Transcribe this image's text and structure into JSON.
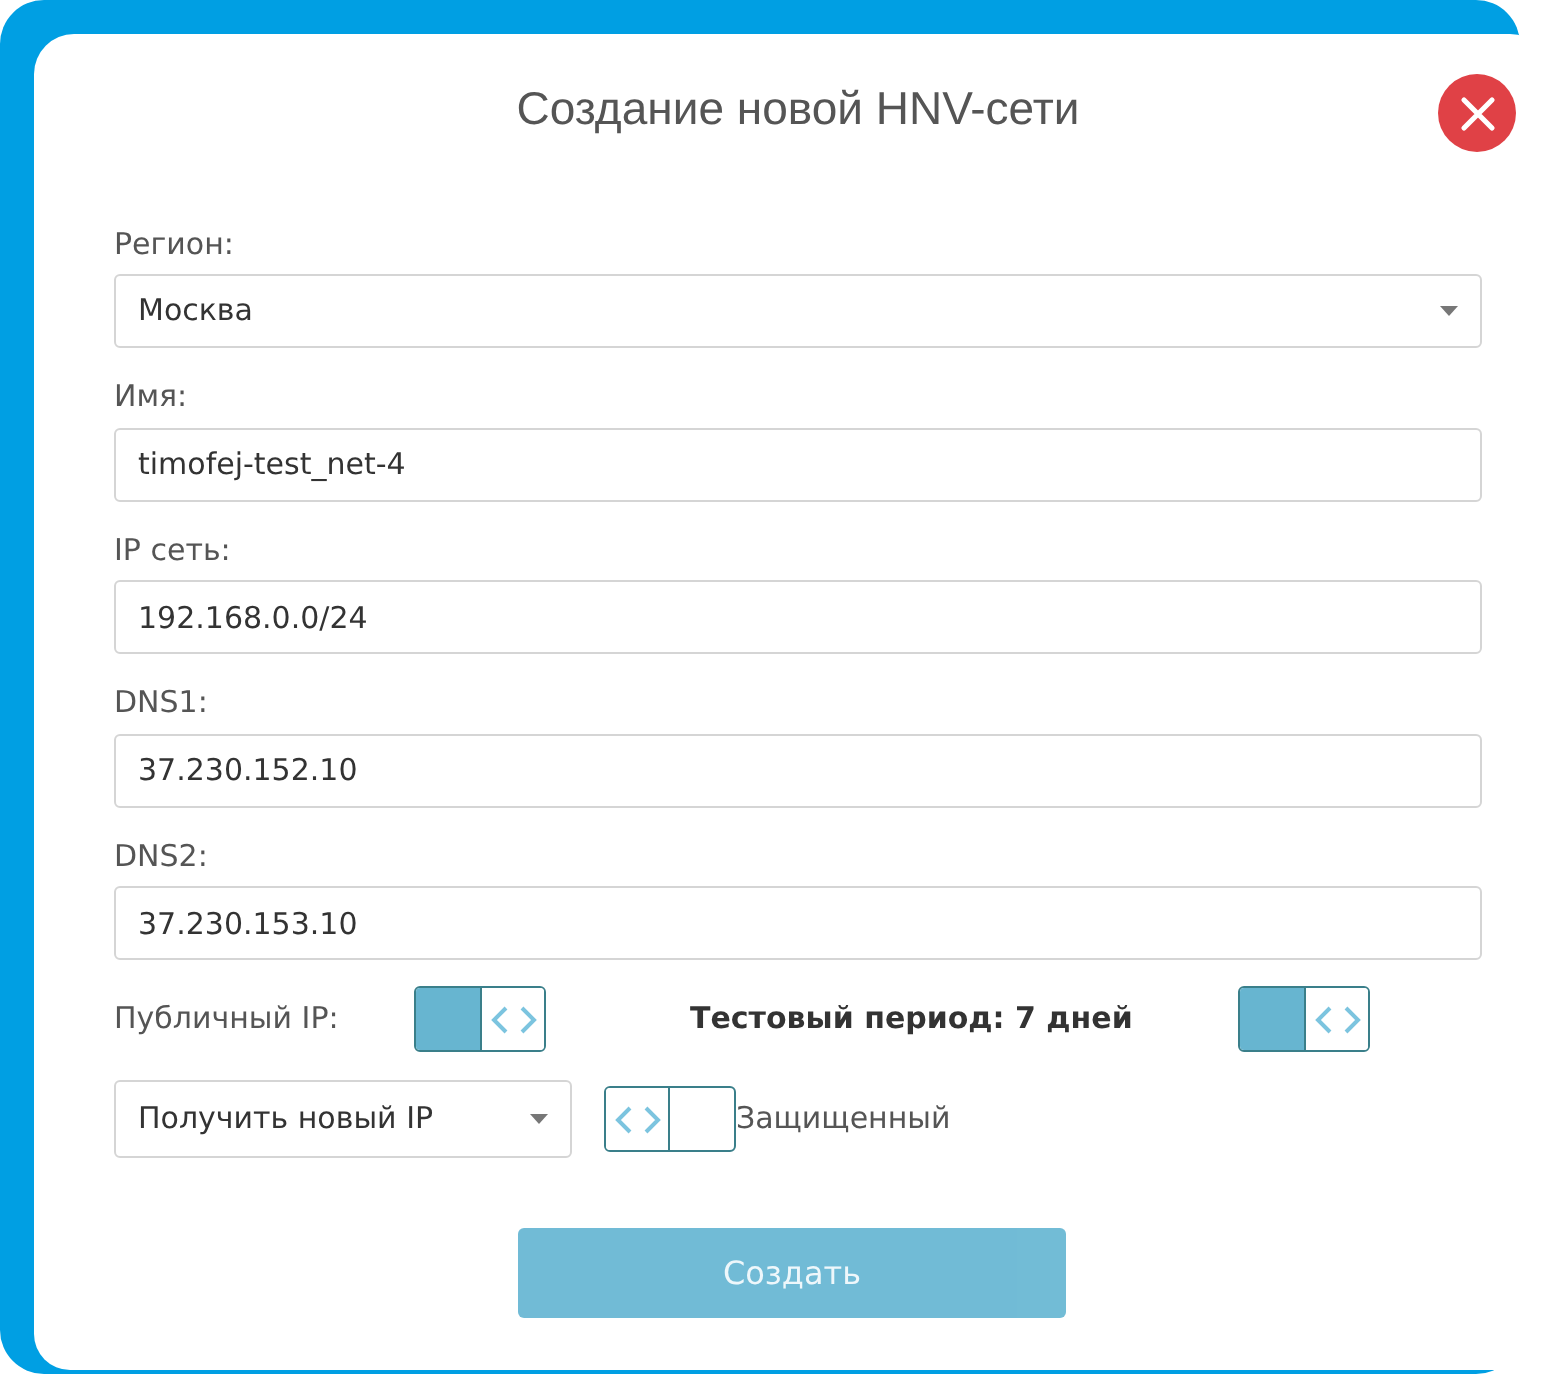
{
  "dialog": {
    "title": "Создание новой HNV-сети"
  },
  "fields": [
    {
      "kind": "select",
      "label": "Регион:",
      "value": "Москва"
    },
    {
      "kind": "text",
      "label": "Имя:",
      "value": "timofej-test_net-4"
    },
    {
      "kind": "text",
      "label": "IP сеть:",
      "value": "192.168.0.0/24"
    },
    {
      "kind": "text",
      "label": "DNS1:",
      "value": "37.230.152.10"
    },
    {
      "kind": "text",
      "label": "DNS2:",
      "value": "37.230.153.10"
    }
  ],
  "public_ip": {
    "label": "Публичный IP:",
    "on": true
  },
  "test_period": {
    "label": "Тестовый период: 7 дней",
    "on": true
  },
  "ip_select": {
    "value": "Получить новый IP"
  },
  "protected": {
    "label": "Защищенный",
    "on": false
  },
  "submit": {
    "label": "Создать",
    "disabled": true
  }
}
